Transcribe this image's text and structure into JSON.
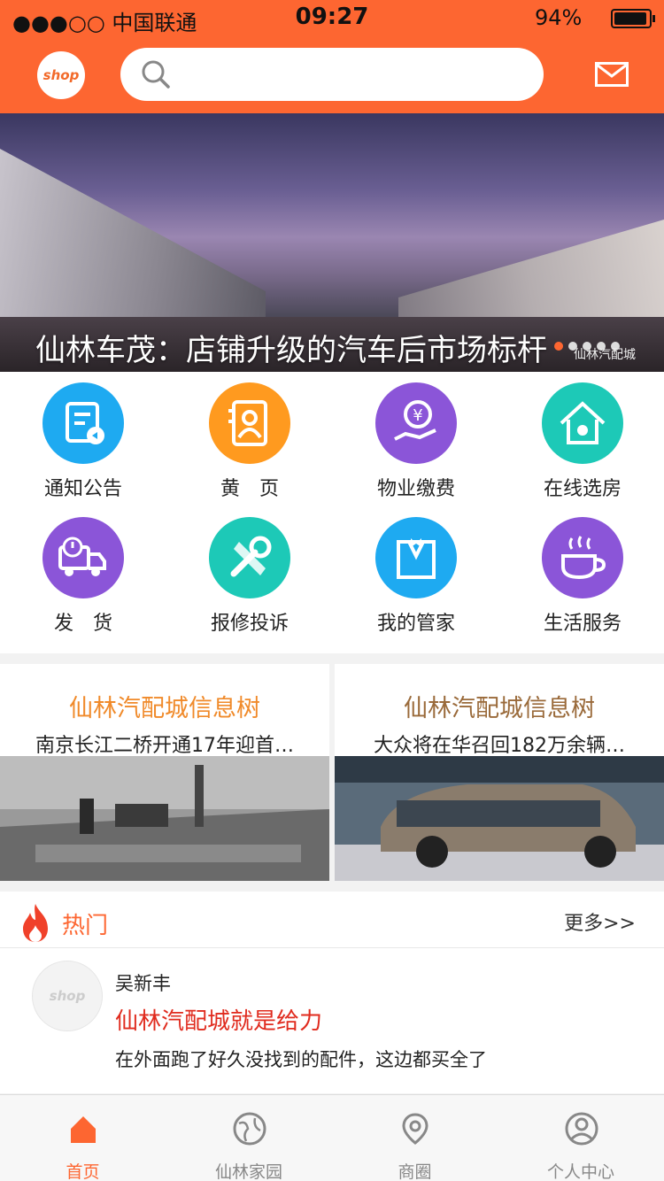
{
  "status_bar": {
    "carrier": "●●●○○ 中国联通",
    "time": "09:27",
    "battery": "94%"
  },
  "header": {
    "logo_text": "shop",
    "search_placeholder": ""
  },
  "banner": {
    "caption": "仙林车茂：店铺升级的汽车后市场标杆",
    "watermark": "仙林汽配城",
    "dot_count": 5,
    "active_dot": 0
  },
  "menu": [
    {
      "label": "通知公告",
      "color": "#1eaaf1",
      "icon": "notice-icon"
    },
    {
      "label": "黄　页",
      "color": "#ff9a1f",
      "icon": "yellow-pages-icon"
    },
    {
      "label": "物业缴费",
      "color": "#8b55d8",
      "icon": "payment-icon"
    },
    {
      "label": "在线选房",
      "color": "#1dc9b7",
      "icon": "house-icon"
    },
    {
      "label": "发　货",
      "color": "#8b55d8",
      "icon": "delivery-truck-icon"
    },
    {
      "label": "报修投诉",
      "color": "#1dc9b7",
      "icon": "repair-icon"
    },
    {
      "label": "我的管家",
      "color": "#1eaaf1",
      "icon": "butler-icon"
    },
    {
      "label": "生活服务",
      "color": "#8b55d8",
      "icon": "coffee-icon"
    }
  ],
  "news": [
    {
      "title": "仙林汽配城信息树",
      "subtitle": "南京长江二桥开通17年迎首…",
      "title_color": "#f08a2a"
    },
    {
      "title": "仙林汽配城信息树",
      "subtitle": "大众将在华召回182万余辆…",
      "title_color": "#9a6a3a"
    }
  ],
  "hot": {
    "label": "热门",
    "more": "更多>>",
    "post": {
      "avatar_text": "shop",
      "user": "吴新丰",
      "title": "仙林汽配城就是给力",
      "body": "在外面跑了好久没找到的配件，这边都买全了"
    }
  },
  "tabbar": [
    {
      "label": "首页",
      "icon": "home-icon",
      "active": true
    },
    {
      "label": "仙林家园",
      "icon": "globe-icon",
      "active": false
    },
    {
      "label": "商圈",
      "icon": "location-pin-icon",
      "active": false
    },
    {
      "label": "个人中心",
      "icon": "user-icon",
      "active": false
    }
  ]
}
